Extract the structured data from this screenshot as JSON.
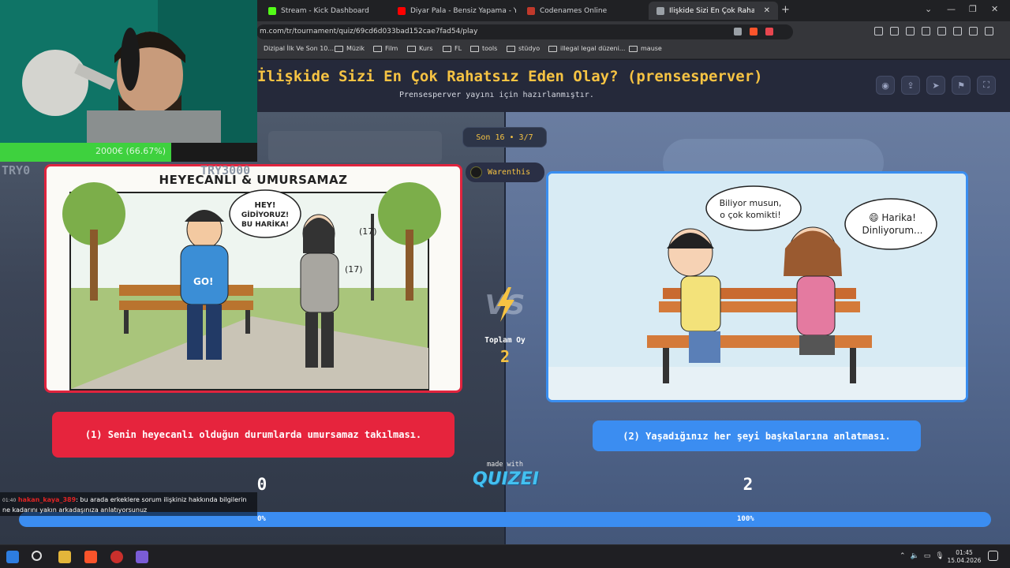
{
  "browser": {
    "tabs": [
      {
        "label": "Stream - Kick Dashboard",
        "favicon_color": "#53fc18"
      },
      {
        "label": "Diyar Pala - Bensiz Yapama - You",
        "favicon_color": "#ff0000"
      },
      {
        "label": "Codenames Online",
        "favicon_color": "#c0392b"
      },
      {
        "label": "İlişkide Sizi En Çok Rahatsız Eden",
        "favicon_color": "#9aa0a6"
      }
    ],
    "url": "m.com/tr/tournament/quiz/69cd6d033bad152cae7fad54/play",
    "bookmarks": [
      "Dizipal İlk Ve Son 10...",
      "Müzik",
      "Film",
      "Kurs",
      "FL",
      "tools",
      "stüdyo",
      "illegal legal düzeni...",
      "mause"
    ]
  },
  "quiz": {
    "title": "İlişkide Sizi En Çok Rahatsız Eden Olay? (prensesperver)",
    "subtitle": "Prensesperver yayını için hazırlanmıştır.",
    "round": "Son 16 • 3/7",
    "user": "Warenthis",
    "total_votes_label": "Toplam Oy",
    "total_votes": "2",
    "left": {
      "image_title": "HEYECANLI & UMURSAMAZ",
      "bubble": "HEY! GİDİYORUZ! BU HARİKA!",
      "age_a": "(17)",
      "age_b": "(17)",
      "shirt": "GO!",
      "choice": "(1) Senin heyecanlı olduğun durumlarda umursamaz takılması.",
      "votes": "0",
      "percent_label": "0%"
    },
    "right": {
      "bubble_a": "Biliyor musun, o çok komikti!",
      "bubble_b": "😄 Harika! Dinliyorum...",
      "choice": "(2) Yaşadığınız her şeyi başkalarına anlatması.",
      "votes": "2",
      "percent_label": "100%"
    },
    "left_fraction": 0.0,
    "made_with": "made with",
    "brand": "QUIZEI"
  },
  "stream": {
    "goal_text": "2000€ (66.67%)",
    "goal_fraction": 0.6667,
    "try_left": "TRY0",
    "try_mid": "TRY3000",
    "chat_time": "01:40",
    "chat_user": "hakan_kaya_389",
    "chat_message": ": bu arada erkeklere sorum ilişkiniz hakkında bilgilerin ne kadarını yakın arkadaşınıza anlatıyorsunuz"
  },
  "taskbar": {
    "time": "01:45",
    "date": "15.04.2026"
  },
  "colors": {
    "left_accent": "#e6243d",
    "right_accent": "#3b8df1",
    "title_color": "#f6c343"
  }
}
